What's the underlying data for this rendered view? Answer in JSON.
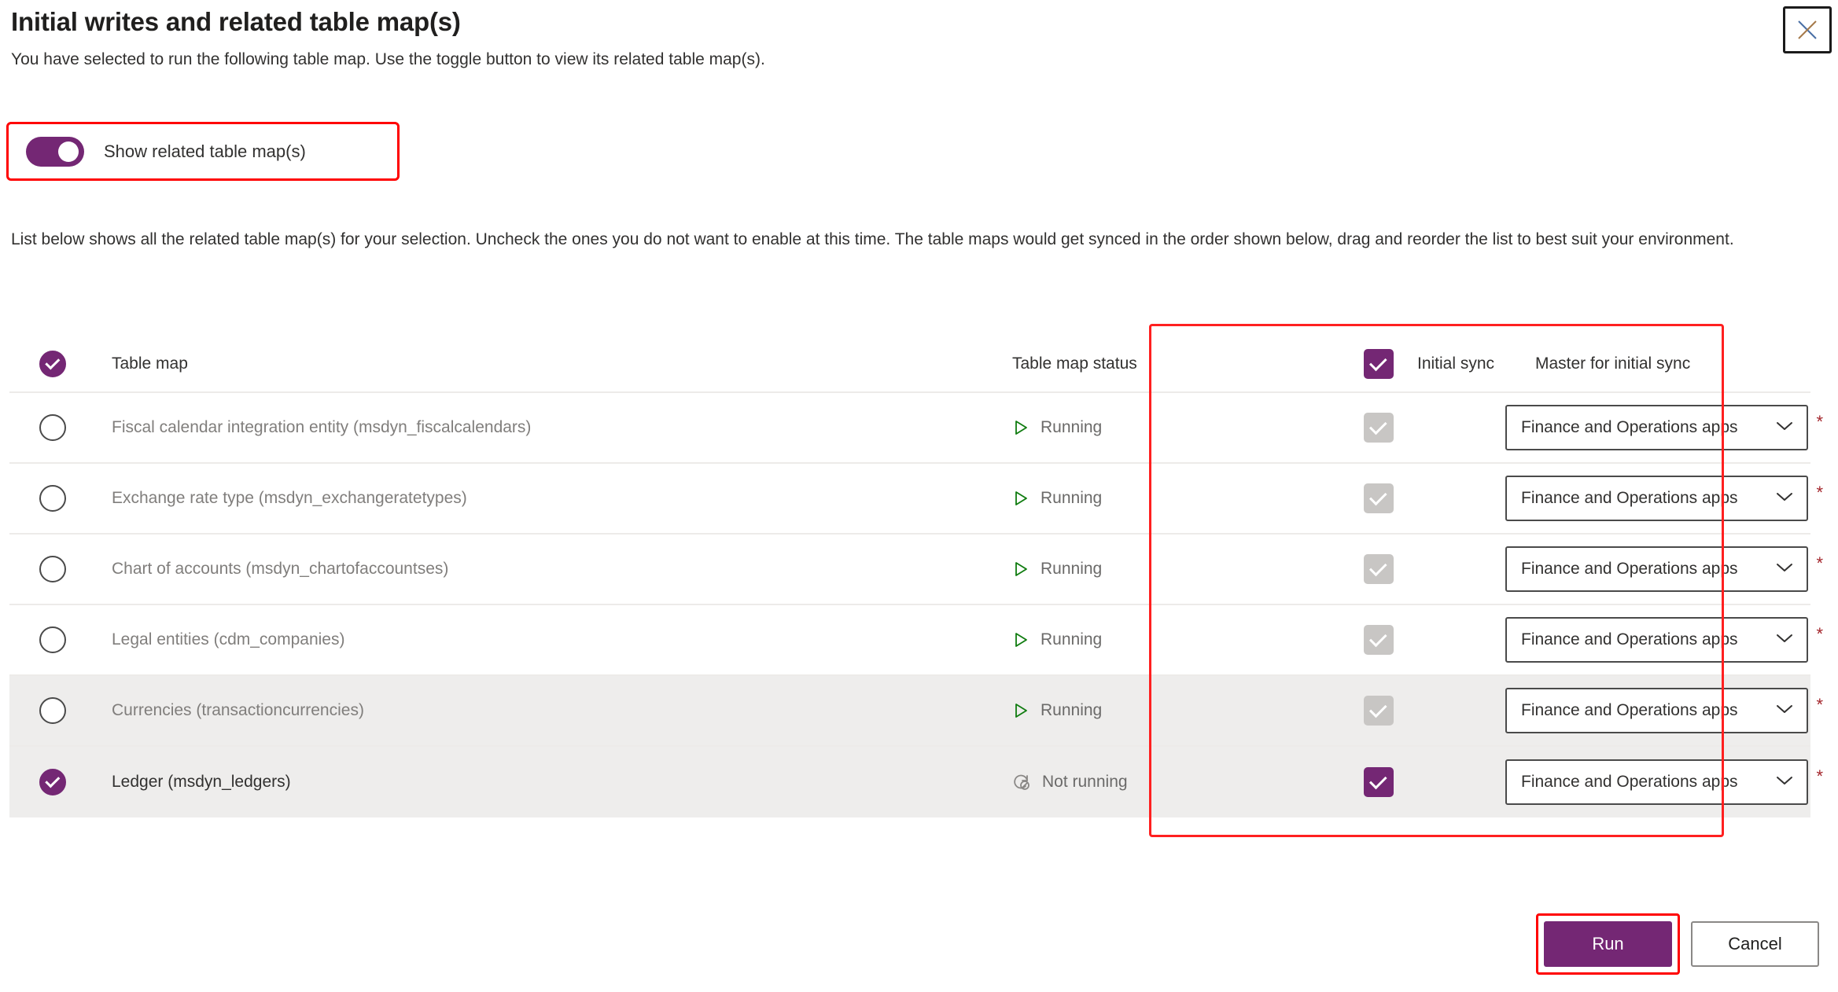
{
  "dialog": {
    "title": "Initial writes and related table map(s)",
    "subtitle": "You have selected to run the following table map. Use the toggle button to view its related table map(s).",
    "description": "List below shows all the related table map(s) for your selection. Uncheck the ones you do not want to enable at this time. The table maps would get synced in the order shown below, drag and reorder the list to best suit your environment.",
    "close_icon": "close-icon"
  },
  "toggle": {
    "label": "Show related table map(s)",
    "state": "on",
    "accent": "#742774",
    "highlight_color": "#ff0000"
  },
  "table": {
    "headers": {
      "select_all_checked": true,
      "table_map": "Table map",
      "table_map_status": "Table map status",
      "initial_sync": "Initial sync",
      "initial_sync_checked": true,
      "master_for_initial_sync": "Master for initial sync"
    },
    "rows": [
      {
        "selected": false,
        "name": "Fiscal calendar integration entity (msdyn_fiscalcalendars)",
        "status": "Running",
        "status_icon": "play-triangle-icon",
        "initial_sync_checked": true,
        "initial_sync_disabled": true,
        "master": "Finance and Operations apps",
        "required": "*",
        "shaded": false
      },
      {
        "selected": false,
        "name": "Exchange rate type (msdyn_exchangeratetypes)",
        "status": "Running",
        "status_icon": "play-triangle-icon",
        "initial_sync_checked": true,
        "initial_sync_disabled": true,
        "master": "Finance and Operations apps",
        "required": "*",
        "shaded": false
      },
      {
        "selected": false,
        "name": "Chart of accounts (msdyn_chartofaccountses)",
        "status": "Running",
        "status_icon": "play-triangle-icon",
        "initial_sync_checked": true,
        "initial_sync_disabled": true,
        "master": "Finance and Operations apps",
        "required": "*",
        "shaded": false
      },
      {
        "selected": false,
        "name": "Legal entities (cdm_companies)",
        "status": "Running",
        "status_icon": "play-triangle-icon",
        "initial_sync_checked": true,
        "initial_sync_disabled": true,
        "master": "Finance and Operations apps",
        "required": "*",
        "shaded": false
      },
      {
        "selected": false,
        "name": "Currencies (transactioncurrencies)",
        "status": "Running",
        "status_icon": "play-triangle-icon",
        "initial_sync_checked": true,
        "initial_sync_disabled": true,
        "master": "Finance and Operations apps",
        "required": "*",
        "shaded": true
      },
      {
        "selected": true,
        "name": "Ledger (msdyn_ledgers)",
        "status": "Not running",
        "status_icon": "sync-blocked-icon",
        "initial_sync_checked": true,
        "initial_sync_disabled": false,
        "master": "Finance and Operations apps",
        "required": "*",
        "shaded": true
      }
    ]
  },
  "footer": {
    "run_label": "Run",
    "cancel_label": "Cancel",
    "run_highlight_color": "#ff0000"
  }
}
